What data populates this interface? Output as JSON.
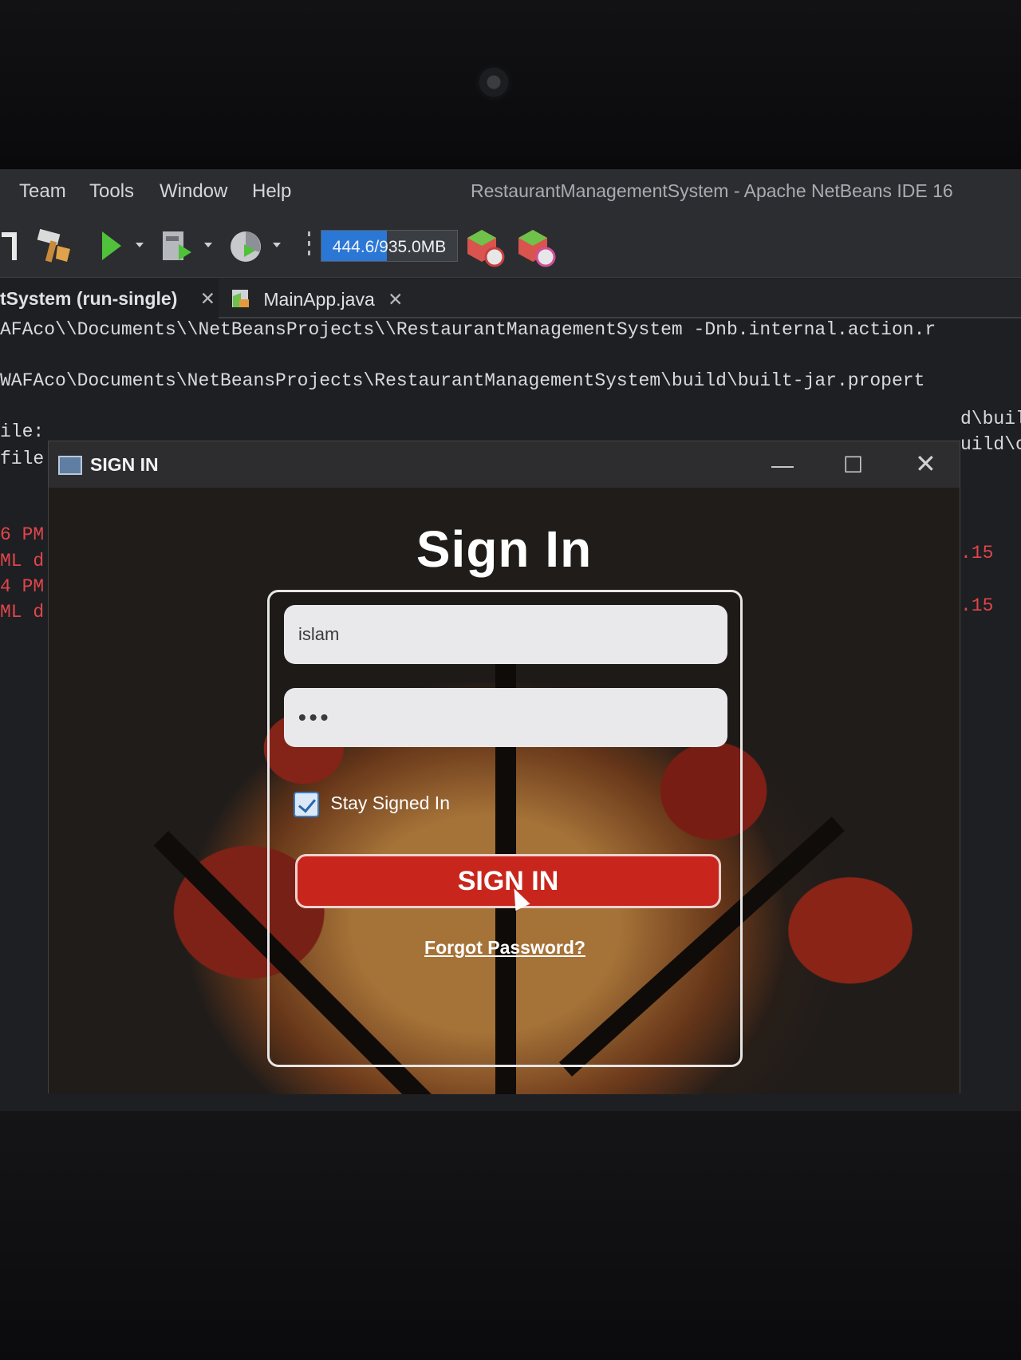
{
  "ide": {
    "menu": [
      "Team",
      "Tools",
      "Window",
      "Help"
    ],
    "title": "RestaurantManagementSystem - Apache NetBeans IDE 16",
    "memory": {
      "label": "444.6/935.0MB",
      "used_fraction": 0.48
    },
    "tabs": [
      {
        "label": "tSystem (run-single)",
        "close": "✕"
      },
      {
        "label": "MainApp.java",
        "close": "✕"
      }
    ],
    "console": {
      "line1": "AFAco\\\\Documents\\\\NetBeansProjects\\\\RestaurantManagementSystem -Dnb.internal.action.r",
      "line2": "WAFAco\\Documents\\NetBeansProjects\\RestaurantManagementSystem\\build\\built-jar.propert",
      "line3": "ile:",
      "line4": "file",
      "line3_right": "d\\buil",
      "line4_right": "uild\\c",
      "red1": "6 PM",
      "red2": "ML d",
      "red3": "4 PM",
      "red4": "ML d",
      "red_right1": ".15",
      "red_right2": ".15"
    }
  },
  "dialog": {
    "title": "SIGN IN",
    "minimize": "—",
    "maximize": "☐",
    "close": "✕",
    "heading": "Sign In",
    "username": {
      "value": "islam"
    },
    "password": {
      "value": "•••"
    },
    "stay_signed_in": {
      "label": "Stay Signed In",
      "checked": true
    },
    "signin_button": "SIGN IN",
    "forgot_password": "Forgot Password?"
  },
  "colors": {
    "accent_red": "#c8261d",
    "memory_bar": "#2b77d6",
    "console_error": "#e0454b"
  }
}
